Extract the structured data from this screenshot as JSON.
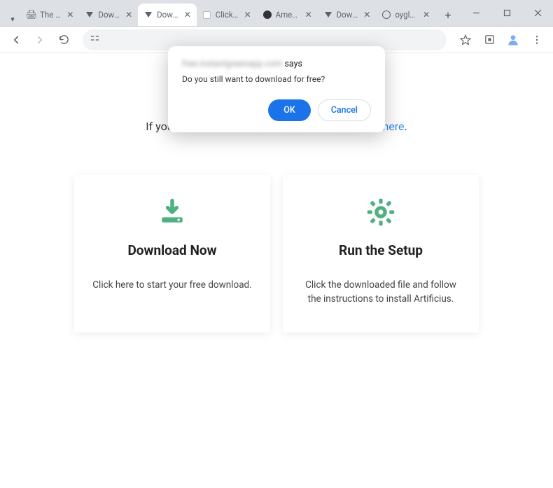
{
  "tabs": [
    {
      "label": "The Pirate"
    },
    {
      "label": "Downloa…"
    },
    {
      "label": "Downloa…"
    },
    {
      "label": "Click Allo…"
    },
    {
      "label": "American…"
    },
    {
      "label": "Downloa…"
    },
    {
      "label": "oyglk.flar…"
    }
  ],
  "dialog": {
    "site_suffix": " says",
    "message": "Do you still want to download for free?",
    "ok": "OK",
    "cancel": "Cancel"
  },
  "header": {
    "prefix": "If your download didn't start automatically ",
    "link": "click here",
    "suffix": "."
  },
  "cards": {
    "download": {
      "title": "Download Now",
      "desc": "Click here to start your free download."
    },
    "setup": {
      "title": "Run the Setup",
      "desc": "Click the downloaded file and follow the instructions to install Artificius."
    }
  }
}
